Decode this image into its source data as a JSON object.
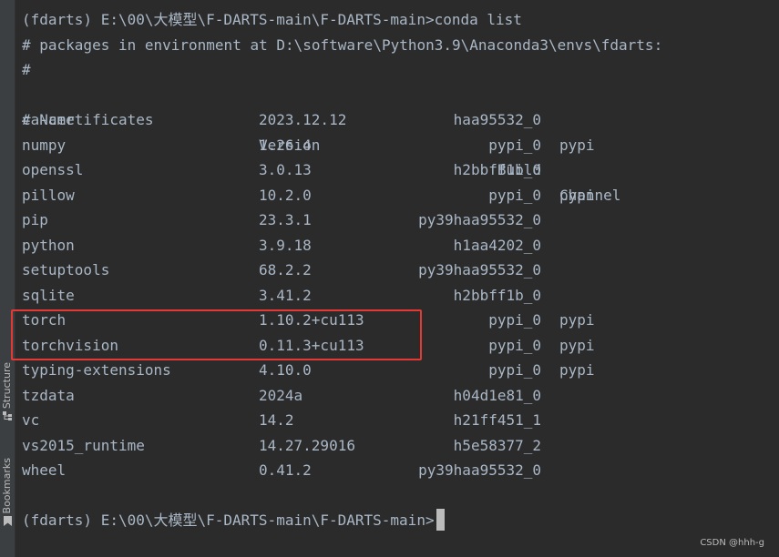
{
  "sidebar": {
    "tabs": [
      {
        "label": "Structure",
        "icon": "structure-icon"
      },
      {
        "label": "Bookmarks",
        "icon": "bookmark-icon"
      }
    ]
  },
  "terminal": {
    "command_line": "(fdarts) E:\\00\\大模型\\F-DARTS-main\\F-DARTS-main>conda list",
    "env_line": "# packages in environment at D:\\software\\Python3.9\\Anaconda3\\envs\\fdarts:",
    "hash_line": "#",
    "headers": {
      "name": "# Name",
      "version": "Version",
      "build": "Build",
      "channel": "Channel"
    },
    "packages": [
      {
        "name": "ca-certificates",
        "version": "2023.12.12",
        "build": "haa95532_0",
        "channel": ""
      },
      {
        "name": "numpy",
        "version": "1.26.4",
        "build": "pypi_0",
        "channel": "pypi"
      },
      {
        "name": "openssl",
        "version": "3.0.13",
        "build": "h2bbff1b_0",
        "channel": ""
      },
      {
        "name": "pillow",
        "version": "10.2.0",
        "build": "pypi_0",
        "channel": "pypi"
      },
      {
        "name": "pip",
        "version": "23.3.1",
        "build": "py39haa95532_0",
        "channel": ""
      },
      {
        "name": "python",
        "version": "3.9.18",
        "build": "h1aa4202_0",
        "channel": ""
      },
      {
        "name": "setuptools",
        "version": "68.2.2",
        "build": "py39haa95532_0",
        "channel": ""
      },
      {
        "name": "sqlite",
        "version": "3.41.2",
        "build": "h2bbff1b_0",
        "channel": ""
      },
      {
        "name": "torch",
        "version": "1.10.2+cu113",
        "build": "pypi_0",
        "channel": "pypi"
      },
      {
        "name": "torchvision",
        "version": "0.11.3+cu113",
        "build": "pypi_0",
        "channel": "pypi"
      },
      {
        "name": "typing-extensions",
        "version": "4.10.0",
        "build": "pypi_0",
        "channel": "pypi"
      },
      {
        "name": "tzdata",
        "version": "2024a",
        "build": "h04d1e81_0",
        "channel": ""
      },
      {
        "name": "vc",
        "version": "14.2",
        "build": "h21ff451_1",
        "channel": ""
      },
      {
        "name": "vs2015_runtime",
        "version": "14.27.29016",
        "build": "h5e58377_2",
        "channel": ""
      },
      {
        "name": "wheel",
        "version": "0.41.2",
        "build": "py39haa95532_0",
        "channel": ""
      }
    ],
    "prompt": "(fdarts) E:\\00\\大模型\\F-DARTS-main\\F-DARTS-main>"
  },
  "watermark": "CSDN @hhh-g",
  "colors": {
    "background": "#2b2b2b",
    "text": "#a9b7c6",
    "highlight_border": "#e53935"
  }
}
